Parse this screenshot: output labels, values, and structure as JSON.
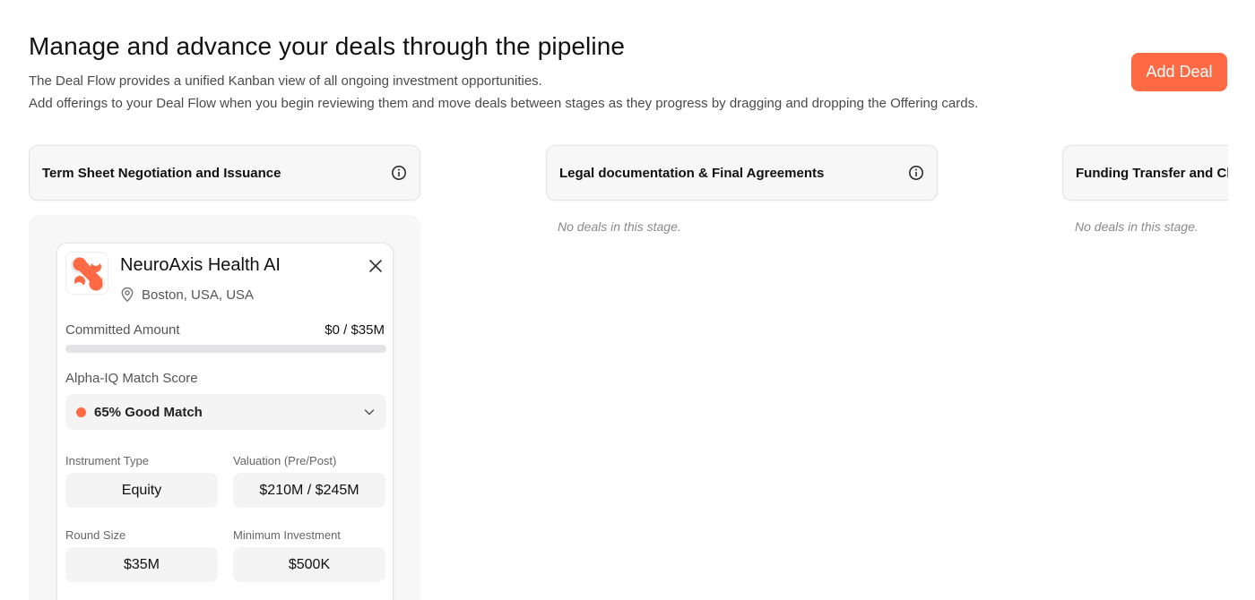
{
  "header": {
    "title": "Manage and advance your deals through the pipeline",
    "subtitle_line1": "The Deal Flow provides a unified Kanban view of all ongoing investment opportunities.",
    "subtitle_line2": "Add offerings to your Deal Flow when you begin reviewing them and move deals between stages as they progress by dragging and dropping the Offering cards.",
    "add_deal_label": "Add Deal"
  },
  "colors": {
    "accent": "#ff6a45",
    "panel_bg": "#f7f7f7",
    "field_bg": "#f4f4f5"
  },
  "columns": [
    {
      "title": "Term Sheet Negotiation and Issuance",
      "icon": "info-icon",
      "empty_text": ""
    },
    {
      "title": "Legal documentation & Final Agreements",
      "icon": "info-icon",
      "empty_text": "No deals in this stage."
    },
    {
      "title": "Funding Transfer and Closing",
      "icon": "info-icon",
      "empty_text": "No deals in this stage."
    }
  ],
  "deal_card": {
    "company_name": "NeuroAxis Health AI",
    "location": "Boston, USA, USA",
    "logo_icon": "neuroaxis-logo",
    "committed_label": "Committed Amount",
    "committed_value": "$0 / $35M",
    "committed_progress": 0,
    "match_label": "Alpha-IQ Match Score",
    "match_value": "65% Good Match",
    "fields": {
      "instrument_type": {
        "label": "Instrument Type",
        "value": "Equity"
      },
      "valuation": {
        "label": "Valuation (Pre/Post)",
        "value": "$210M / $245M"
      },
      "round_size": {
        "label": "Round Size",
        "value": "$35M"
      },
      "minimum_investment": {
        "label": "Minimum Investment",
        "value": "$500K"
      }
    }
  }
}
